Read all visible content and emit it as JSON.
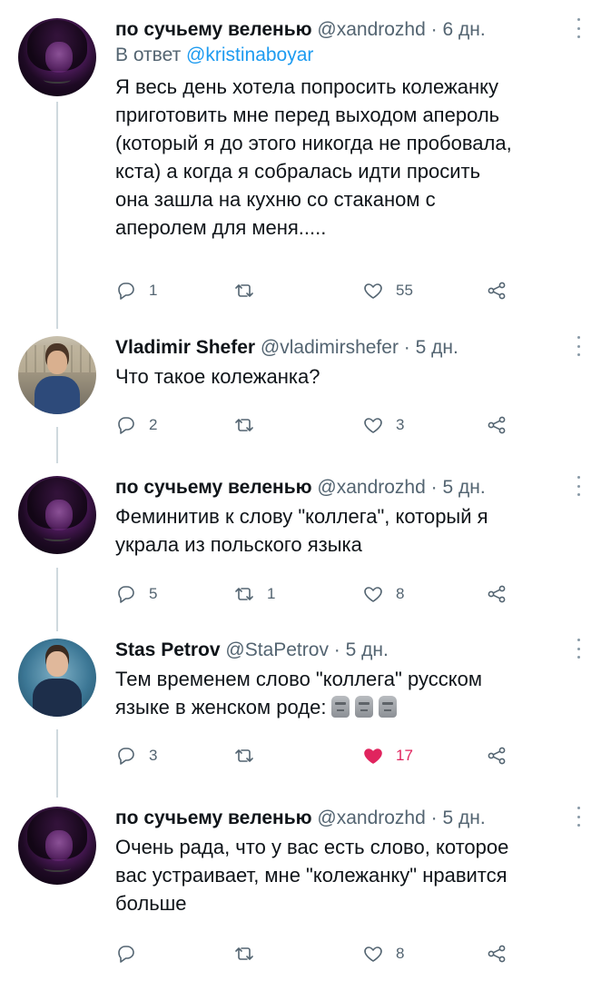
{
  "tweets": [
    {
      "name": "по сучьему веленью",
      "handle": "@xandrozhd",
      "time": "· 6 дн.",
      "reply_prefix": "В ответ",
      "reply_mention": "@kristinaboyar",
      "text": "Я весь день хотела попросить колежанку\nприготовить мне перед выходом апероль\n(который я до этого никогда не пробовала,\nкста) а когда я собралась идти просить\nона зашла на кухню со стаканом с\nаперолем для меня.....",
      "replies": "1",
      "retweets": "",
      "likes": "55",
      "liked": false
    },
    {
      "name": "Vladimir Shefer",
      "handle": "@vladimirshefer",
      "time": "· 5 дн.",
      "text": "Что такое колежанка?",
      "replies": "2",
      "retweets": "",
      "likes": "3",
      "liked": false
    },
    {
      "name": "по сучьему веленью",
      "handle": "@xandrozhd",
      "time": "· 5 дн.",
      "text": "Феминитив к слову \"коллега\", который я\nукрала из польского языка",
      "replies": "5",
      "retweets": "1",
      "likes": "8",
      "liked": false
    },
    {
      "name": "Stas Petrov",
      "handle": "@StaPetrov",
      "time": "· 5 дн.",
      "text": "Тем временем слово \"коллега\" русском\nязыке в женском роде:",
      "emoji": [
        "moai-icon",
        "moai-icon",
        "moai-icon"
      ],
      "replies": "3",
      "retweets": "",
      "likes": "17",
      "liked": true
    },
    {
      "name": "по сучьему веленью",
      "handle": "@xandrozhd",
      "time": "· 5 дн.",
      "text": "Очень рада, что у вас есть слово, которое\nвас устраивает, мне \"колежанку\" нравится\nбольше",
      "replies": "",
      "retweets": "",
      "likes": "8",
      "liked": false
    }
  ],
  "colors": {
    "link": "#1d9bf0",
    "muted": "#536471",
    "like_active": "#e0245e",
    "thread_line": "#cfd9de"
  }
}
